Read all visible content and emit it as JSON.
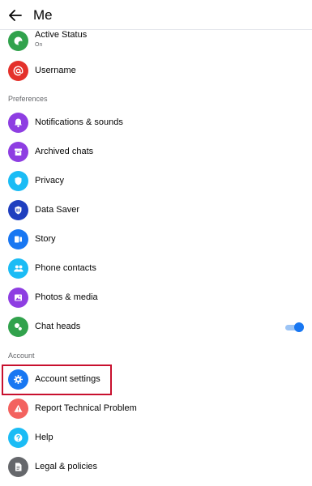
{
  "header": {
    "title": "Me"
  },
  "items": {
    "active_status": {
      "label": "Active Status",
      "sub": "On",
      "icon": "active-status-icon",
      "color": "#31a24c"
    },
    "username": {
      "label": "Username",
      "icon": "at-sign-icon",
      "color": "#e4312b"
    },
    "notifications": {
      "label": "Notifications & sounds",
      "icon": "bell-icon",
      "color": "#8e3ee2"
    },
    "archived": {
      "label": "Archived chats",
      "icon": "archive-box-icon",
      "color": "#8e3ee2"
    },
    "privacy": {
      "label": "Privacy",
      "icon": "shield-icon",
      "color": "#1bbcf5"
    },
    "data_saver": {
      "label": "Data Saver",
      "icon": "data-saver-icon",
      "color": "#1f3fbf"
    },
    "story": {
      "label": "Story",
      "icon": "story-icon",
      "color": "#1877f2"
    },
    "phone_contacts": {
      "label": "Phone contacts",
      "icon": "people-icon",
      "color": "#1bbcf5"
    },
    "photos_media": {
      "label": "Photos & media",
      "icon": "photo-icon",
      "color": "#8e3ee2"
    },
    "chat_heads": {
      "label": "Chat heads",
      "icon": "chat-heads-icon",
      "color": "#31a24c",
      "toggle_on": true
    },
    "account_settings": {
      "label": "Account settings",
      "icon": "gear-icon",
      "color": "#1877f2"
    },
    "report_problem": {
      "label": "Report Technical Problem",
      "icon": "warning-icon",
      "color": "#f3625f"
    },
    "help": {
      "label": "Help",
      "icon": "question-icon",
      "color": "#1bbcf5"
    },
    "legal": {
      "label": "Legal & policies",
      "icon": "document-icon",
      "color": "#65676b"
    }
  },
  "sections": {
    "preferences": "Preferences",
    "account": "Account"
  },
  "colors": {
    "accent": "#1877f2",
    "highlight": "#c8102e"
  }
}
